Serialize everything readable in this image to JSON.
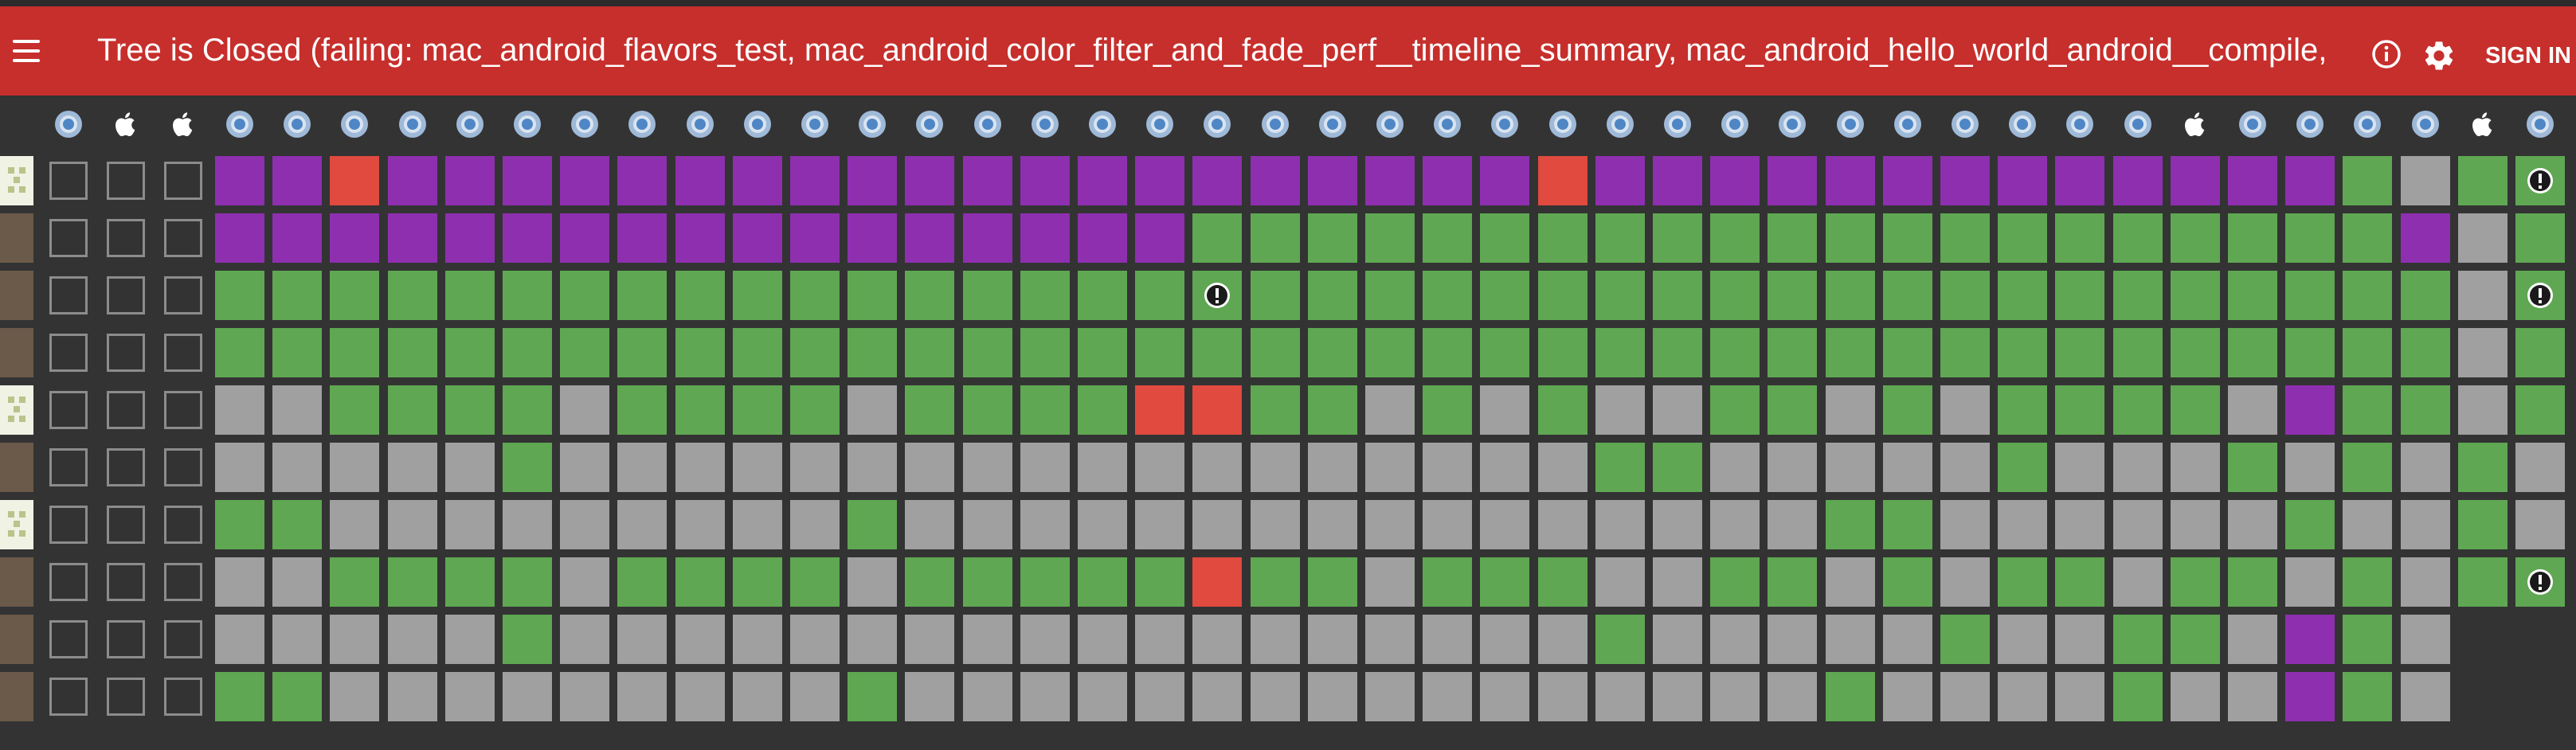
{
  "header": {
    "title": "Tree is Closed (failing: mac_android_flavors_test, mac_android_color_filter_and_fade_perf__timeline_summary, mac_android_hello_world_android__compile, ...",
    "menu_icon": "menu-icon",
    "info_icon": "info-icon",
    "settings_icon": "gear-icon",
    "sign_in_label": "SIGN IN",
    "color": "#c62f2c"
  },
  "task_columns": [
    "chrome",
    "apple",
    "apple",
    "chrome",
    "chrome",
    "chrome",
    "chrome",
    "chrome",
    "chrome",
    "chrome",
    "chrome",
    "chrome",
    "chrome",
    "chrome",
    "chrome",
    "chrome",
    "chrome",
    "chrome",
    "chrome",
    "chrome",
    "chrome",
    "chrome",
    "chrome",
    "chrome",
    "chrome",
    "chrome",
    "chrome",
    "chrome",
    "chrome",
    "chrome",
    "chrome",
    "chrome",
    "chrome",
    "chrome",
    "chrome",
    "chrome",
    "chrome",
    "apple",
    "chrome",
    "chrome",
    "chrome",
    "chrome",
    "apple",
    "chrome"
  ],
  "legend": {
    "P": "#8e2fb0",
    "G": "#5fa752",
    "R": "#e04a3f",
    "Y": "#a0a0a0",
    "S": "#a0a0a0",
    "A": "#5fa752",
    "B": "#5fa752",
    "C": "#a0a0a0"
  },
  "commits": [
    {
      "avatar": "identicon-avatar",
      "cells": "PPRPPPPPPPPPPPPPPPPPPPPRPPPPPPPPPPPPPGSGAG"
    },
    {
      "avatar": "person-avatar",
      "cells": "PPPPPPPPPPPPPPPPPGGGGGGGGGGGGGGGGGGGGGPSGGSGA"
    },
    {
      "avatar": "person-avatar",
      "cells": "GGGGGGGGGGGGGGGGGAGGGGGGGGGGGGGGGGGGGGGSAGGSGG"
    },
    {
      "avatar": "person-avatar",
      "cells": "GGGGGGGGGGGGGGGGGGGGGGGGGGGGGGGGGGGGGGGSGGGSGA"
    },
    {
      "avatar": "identicon-avatar",
      "cells": "SSGGGGSGGGGSGGGGRRGGSGSGSSGGSGSGGGGSPGGSG"
    },
    {
      "avatar": "person-avatar",
      "cells": "SSSSSGSSSSSSSSSSSSSSSSSSGGSSSSSGSSSGSGSGS"
    },
    {
      "avatar": "identicon-avatar",
      "cells": "GGSSSSSSSSSGSSSSSSSSSSSSSSSSGGSSSSSSGSSGS"
    },
    {
      "avatar": "person-avatar",
      "cells": "SSGGGGSGGGGSGGGGGRGGSGGGSSGGSGSGGSGGSGSGA"
    },
    {
      "avatar": "person-avatar",
      "cells": "SSSSSGSSSSSSSSSSSSSSSSSSGSSSSSGSSGGSPGS"
    },
    {
      "avatar": "person-avatar",
      "cells": "GGSSSSSSSSSGSSSSSSSSSSSSSSSSGSSSSGSSPGS"
    }
  ]
}
